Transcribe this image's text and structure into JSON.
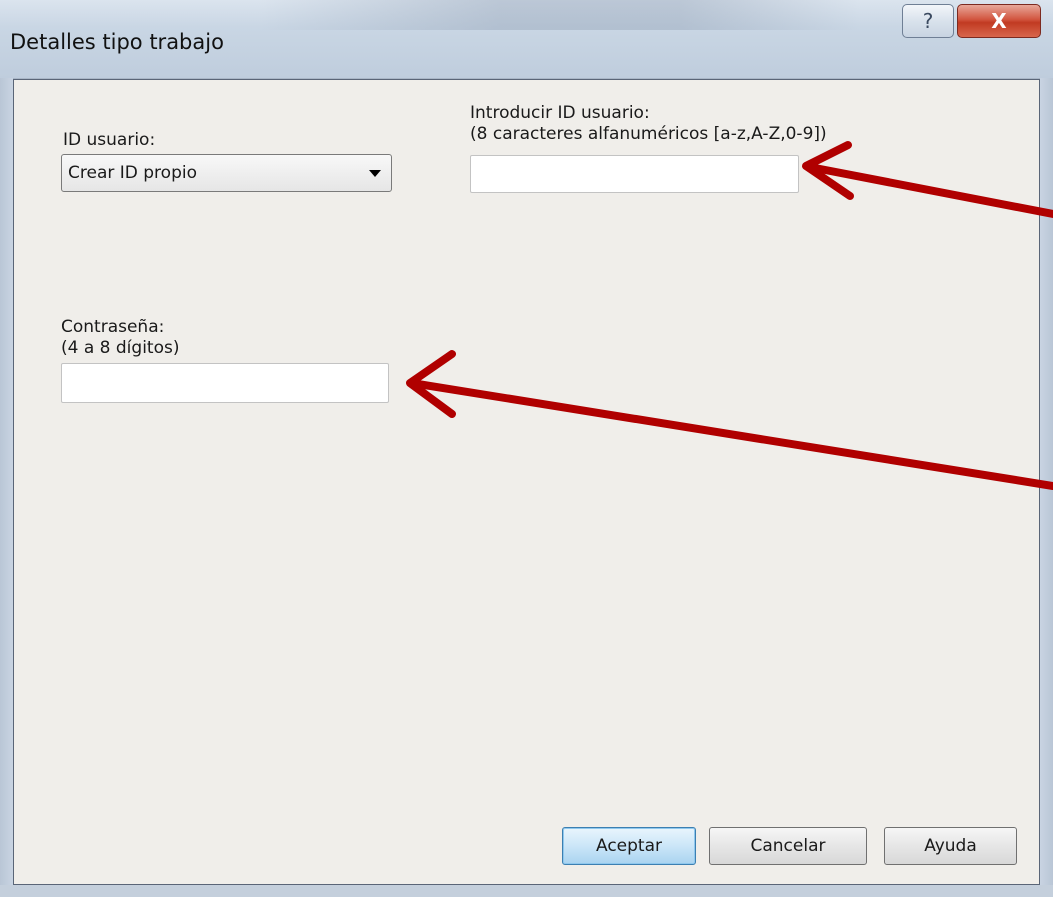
{
  "window": {
    "title": "Detalles tipo trabajo",
    "help_glyph": "?",
    "close_glyph": "X"
  },
  "user_id": {
    "label": "ID usuario:",
    "selected_option": "Crear ID propio"
  },
  "enter_user_id": {
    "label": "Introducir ID usuario:",
    "hint": "(8 caracteres alfanuméricos [a-z,A-Z,0-9])",
    "value": ""
  },
  "password": {
    "label": "Contraseña:",
    "hint": "(4 a 8 dígitos)",
    "value": ""
  },
  "buttons": {
    "accept": "Aceptar",
    "cancel": "Cancelar",
    "help": "Ayuda"
  },
  "colors": {
    "annotation_arrow": "#b00000",
    "dialog_background": "#f0eeea",
    "default_button_border": "#3c7fb1"
  },
  "icons": {
    "help": "question-mark-icon",
    "close": "close-x-icon",
    "dropdown": "triangle-down-icon"
  }
}
